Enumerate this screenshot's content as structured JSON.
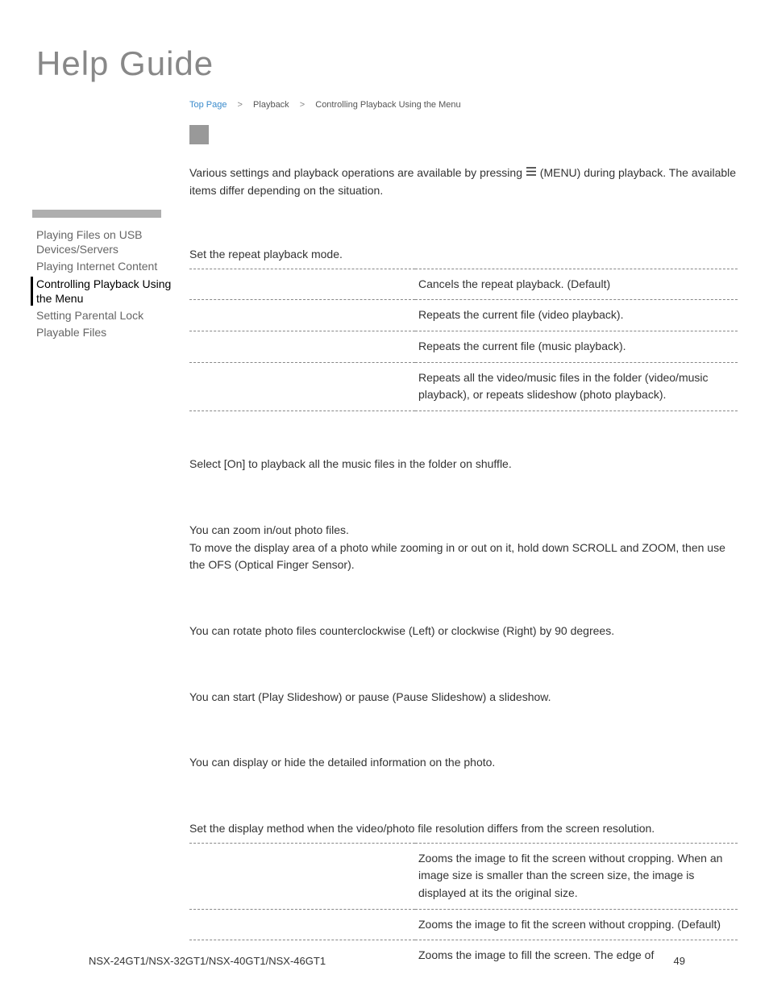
{
  "page_title": "Help Guide",
  "breadcrumb": {
    "link": "Top Page",
    "mid": "Playback",
    "leaf": "Controlling Playback Using the Menu"
  },
  "intro": {
    "l1a": "Various settings and playback operations are available by pressing ",
    "l1b": " (MENU) during playback. The available items differ depending on the situation."
  },
  "sidebar": {
    "items": [
      "Playing Files on USB Devices/Servers",
      "Playing Internet Content",
      "Controlling Playback Using the Menu",
      "Setting Parental Lock",
      "Playable Files"
    ]
  },
  "repeat": {
    "desc": "Set the repeat playback mode.",
    "rows": [
      {
        "d": "Cancels the repeat playback. (Default)"
      },
      {
        "d": "Repeats the current file (video playback)."
      },
      {
        "d": "Repeats the current file (music playback)."
      },
      {
        "d": "Repeats all the video/music files in the folder (video/music playback), or repeats slideshow (photo playback)."
      }
    ]
  },
  "shuffle": "Select [On] to playback all the music files in the folder on shuffle.",
  "zoom": "You can zoom in/out photo files.\nTo move the display area of a photo while zooming in or out on it, hold down SCROLL and ZOOM, then use the OFS (Optical Finger Sensor).",
  "rotate": "You can rotate photo files counterclockwise (Left) or clockwise (Right) by 90 degrees.",
  "slideshow": "You can start (Play Slideshow) or pause (Pause Slideshow) a slideshow.",
  "info": "You can display or hide the detailed information on the photo.",
  "display": {
    "desc": "Set the display method when the video/photo file resolution differs from the screen resolution.",
    "rows": [
      {
        "d": "Zooms the image to fit the screen without cropping. When an image size is smaller than the screen size, the image is displayed at its the original size."
      },
      {
        "d": "Zooms the image to fit the screen without cropping. (Default)"
      },
      {
        "d": "Zooms the image to fill the screen. The edge of"
      }
    ]
  },
  "footer": {
    "model": "NSX-24GT1/NSX-32GT1/NSX-40GT1/NSX-46GT1",
    "page": "49"
  }
}
